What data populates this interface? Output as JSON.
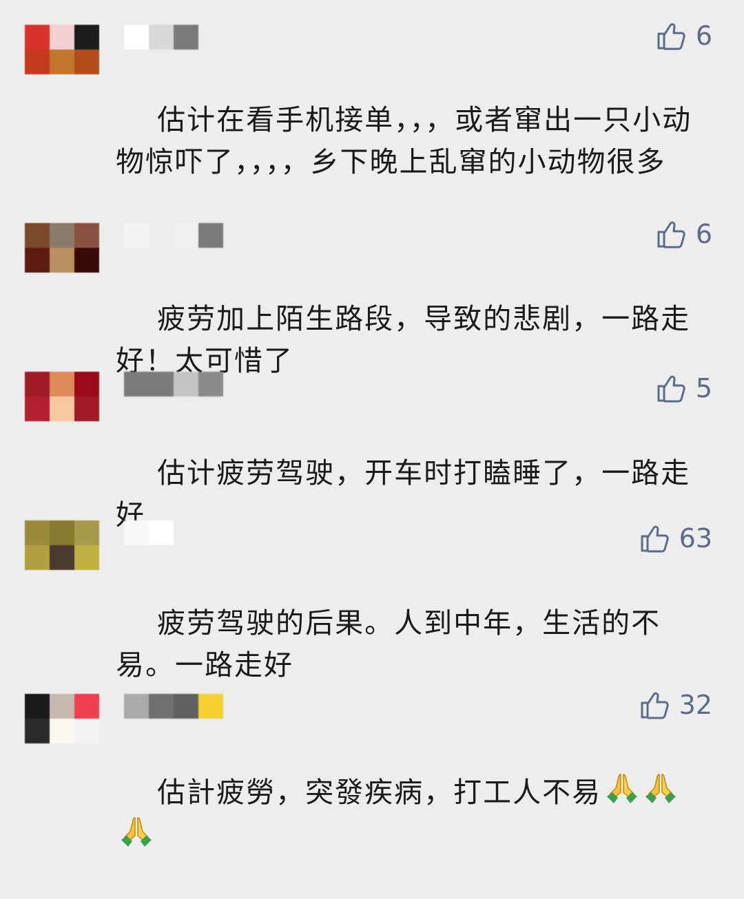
{
  "comments": [
    {
      "avatar_colors": [
        "#d8322a",
        "#f1cfd2",
        "#1c1c1c",
        "#c53a1f",
        "#c2762c",
        "#b04d1a"
      ],
      "name_colors": [
        "#ffffff",
        "#d8d8d8",
        "#7a7a7a"
      ],
      "likes": "6",
      "text": "估计在看手机接单，，，或者窜出一只小动物惊吓了，，，，乡下晚上乱窜的小动物很多",
      "pray_emoji_count": 0
    },
    {
      "avatar_colors": [
        "#7a4a2a",
        "#8a7a6a",
        "#8a5040",
        "#5c1c10",
        "#b89060",
        "#3a0a08"
      ],
      "name_colors": [
        "#f4f4f4",
        "#ededed",
        "#f0f0f0",
        "#7a7a7a"
      ],
      "likes": "6",
      "text": "疲劳加上陌生路段，导致的悲剧，一路走好！太可惜了",
      "pray_emoji_count": 0
    },
    {
      "avatar_colors": [
        "#a01a28",
        "#e08a5a",
        "#9a0a18",
        "#b02030",
        "#f8c8a0",
        "#a01a28"
      ],
      "name_colors": [
        "#7a7a7a",
        "#7a7a7a",
        "#c4c4c4",
        "#8a8a8a"
      ],
      "likes": "5",
      "text": "估计疲劳驾驶，开车时打瞌睡了，一路走好",
      "pray_emoji_count": 0
    },
    {
      "avatar_colors": [
        "#9a8a3a",
        "#8a7a30",
        "#a89a4a",
        "#b0a040",
        "#4a3a30",
        "#c0b040"
      ],
      "name_colors": [
        "#f8f8f8",
        "#ffffff"
      ],
      "likes": "63",
      "text": "疲劳驾驶的后果。人到中年，生活的不易。一路走好",
      "pray_emoji_count": 0
    },
    {
      "avatar_colors": [
        "#1a1a1a",
        "#c8b8b0",
        "#f04050",
        "#2a2a2a",
        "#faf8ee",
        "#f4f4f4"
      ],
      "name_colors": [
        "#aaaaaa",
        "#707070",
        "#606060",
        "#f4d030"
      ],
      "likes": "32",
      "text": "估計疲勞，突發疾病，打工人不易",
      "pray_emoji_count": 3
    }
  ],
  "icons": {
    "like": "thumbs-up-outline-icon",
    "emoji": "folded-hands-emoji"
  },
  "colors": {
    "background": "#ededed",
    "like_color": "#5b6b8c",
    "text_color": "#1a1a1a"
  }
}
